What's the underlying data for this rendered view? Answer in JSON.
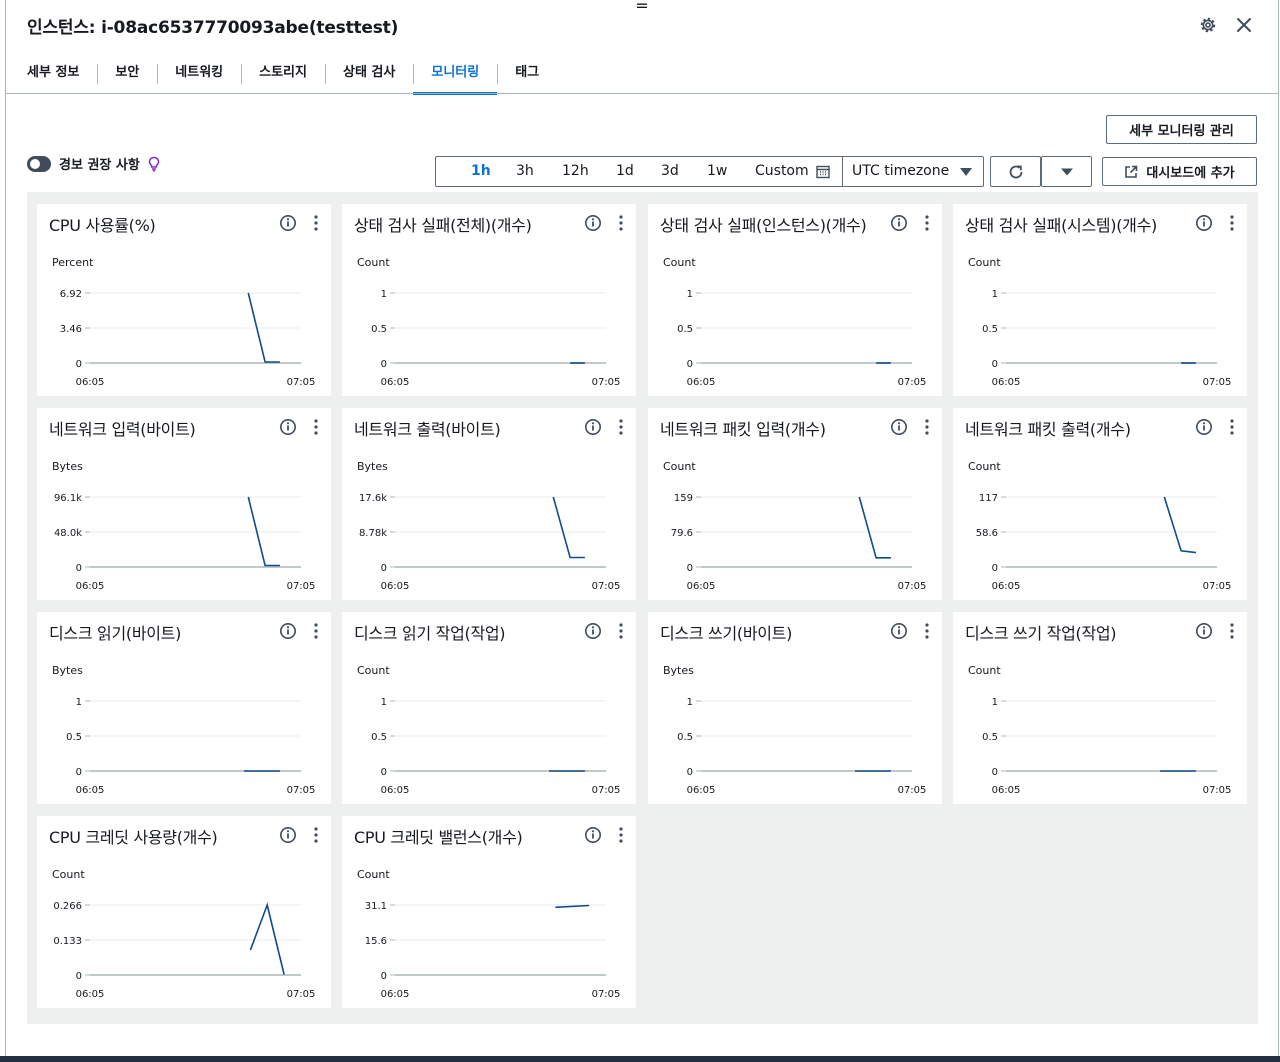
{
  "header": {
    "title": "인스턴스: i-08ac6537770093abe(testtest)",
    "drag_glyph": "=",
    "settings_icon": "gear-icon",
    "close_icon": "close-icon"
  },
  "tabs": [
    {
      "label": "세부 정보",
      "active": false
    },
    {
      "label": "보안",
      "active": false
    },
    {
      "label": "네트워킹",
      "active": false
    },
    {
      "label": "스토리지",
      "active": false
    },
    {
      "label": "상태 검사",
      "active": false
    },
    {
      "label": "모니터링",
      "active": true
    },
    {
      "label": "태그",
      "active": false
    }
  ],
  "toolbar": {
    "manage_monitoring_label": "세부 모니터링 관리",
    "alarm_toggle_label": "경보 권장 사항",
    "alarm_toggle_on": false,
    "time_ranges": [
      "1h",
      "3h",
      "12h",
      "1d",
      "3d",
      "1w",
      "Custom"
    ],
    "selected_time_range": "1h",
    "timezone": "UTC timezone",
    "add_to_dashboard_label": "대시보드에 추가"
  },
  "colors": {
    "accent": "#0972d3",
    "series_line": "#0f4c8a",
    "panel_background": "#eef0f0"
  },
  "widgets": [
    {
      "title": "CPU 사용률(%)",
      "unit": "Percent",
      "y_ticks": [
        "6.92",
        "3.46",
        "0"
      ],
      "x_ticks": [
        "06:05",
        "07:05"
      ]
    },
    {
      "title": "상태 검사 실패(전체)(개수)",
      "unit": "Count",
      "y_ticks": [
        "1",
        "0.5",
        "0"
      ],
      "x_ticks": [
        "06:05",
        "07:05"
      ]
    },
    {
      "title": "상태 검사 실패(인스턴스)(개수)",
      "unit": "Count",
      "y_ticks": [
        "1",
        "0.5",
        "0"
      ],
      "x_ticks": [
        "06:05",
        "07:05"
      ]
    },
    {
      "title": "상태 검사 실패(시스템)(개수)",
      "unit": "Count",
      "y_ticks": [
        "1",
        "0.5",
        "0"
      ],
      "x_ticks": [
        "06:05",
        "07:05"
      ]
    },
    {
      "title": "네트워크 입력(바이트)",
      "unit": "Bytes",
      "y_ticks": [
        "96.1k",
        "48.0k",
        "0"
      ],
      "x_ticks": [
        "06:05",
        "07:05"
      ]
    },
    {
      "title": "네트워크 출력(바이트)",
      "unit": "Bytes",
      "y_ticks": [
        "17.6k",
        "8.78k",
        "0"
      ],
      "x_ticks": [
        "06:05",
        "07:05"
      ]
    },
    {
      "title": "네트워크 패킷 입력(개수)",
      "unit": "Count",
      "y_ticks": [
        "159",
        "79.6",
        "0"
      ],
      "x_ticks": [
        "06:05",
        "07:05"
      ]
    },
    {
      "title": "네트워크 패킷 출력(개수)",
      "unit": "Count",
      "y_ticks": [
        "117",
        "58.6",
        "0"
      ],
      "x_ticks": [
        "06:05",
        "07:05"
      ]
    },
    {
      "title": "디스크 읽기(바이트)",
      "unit": "Bytes",
      "y_ticks": [
        "1",
        "0.5",
        "0"
      ],
      "x_ticks": [
        "06:05",
        "07:05"
      ]
    },
    {
      "title": "디스크 읽기 작업(작업)",
      "unit": "Count",
      "y_ticks": [
        "1",
        "0.5",
        "0"
      ],
      "x_ticks": [
        "06:05",
        "07:05"
      ]
    },
    {
      "title": "디스크 쓰기(바이트)",
      "unit": "Bytes",
      "y_ticks": [
        "1",
        "0.5",
        "0"
      ],
      "x_ticks": [
        "06:05",
        "07:05"
      ]
    },
    {
      "title": "디스크 쓰기 작업(작업)",
      "unit": "Count",
      "y_ticks": [
        "1",
        "0.5",
        "0"
      ],
      "x_ticks": [
        "06:05",
        "07:05"
      ]
    },
    {
      "title": "CPU 크레딧 사용량(개수)",
      "unit": "Count",
      "y_ticks": [
        "0.266",
        "0.133",
        "0"
      ],
      "x_ticks": [
        "06:05",
        "07:05"
      ]
    },
    {
      "title": "CPU 크레딧 밸런스(개수)",
      "unit": "Count",
      "y_ticks": [
        "31.1",
        "15.6",
        "0"
      ],
      "x_ticks": [
        "06:05",
        "07:05"
      ]
    }
  ],
  "chart_data": [
    {
      "type": "line",
      "title": "CPU 사용률(%)",
      "ylabel": "Percent",
      "x_range": [
        "06:05",
        "07:05"
      ],
      "ylim": [
        0,
        6.92
      ],
      "series": [
        {
          "x": [
            0.75,
            0.83,
            0.9
          ],
          "y": [
            6.92,
            0.1,
            0.1
          ]
        }
      ]
    },
    {
      "type": "line",
      "title": "상태 검사 실패(전체)(개수)",
      "ylabel": "Count",
      "x_range": [
        "06:05",
        "07:05"
      ],
      "ylim": [
        0,
        1
      ],
      "series": [
        {
          "x": [
            0.83,
            0.9
          ],
          "y": [
            0,
            0
          ]
        }
      ]
    },
    {
      "type": "line",
      "title": "상태 검사 실패(인스턴스)(개수)",
      "ylabel": "Count",
      "x_range": [
        "06:05",
        "07:05"
      ],
      "ylim": [
        0,
        1
      ],
      "series": [
        {
          "x": [
            0.83,
            0.9
          ],
          "y": [
            0,
            0
          ]
        }
      ]
    },
    {
      "type": "line",
      "title": "상태 검사 실패(시스템)(개수)",
      "ylabel": "Count",
      "x_range": [
        "06:05",
        "07:05"
      ],
      "ylim": [
        0,
        1
      ],
      "series": [
        {
          "x": [
            0.83,
            0.9
          ],
          "y": [
            0,
            0
          ]
        }
      ]
    },
    {
      "type": "line",
      "title": "네트워크 입력(바이트)",
      "ylabel": "Bytes",
      "x_range": [
        "06:05",
        "07:05"
      ],
      "ylim": [
        0,
        96100
      ],
      "series": [
        {
          "x": [
            0.75,
            0.83,
            0.9
          ],
          "y": [
            96100,
            2000,
            2000
          ]
        }
      ]
    },
    {
      "type": "line",
      "title": "네트워크 출력(바이트)",
      "ylabel": "Bytes",
      "x_range": [
        "06:05",
        "07:05"
      ],
      "ylim": [
        0,
        17600
      ],
      "series": [
        {
          "x": [
            0.75,
            0.83,
            0.9
          ],
          "y": [
            17600,
            2400,
            2400
          ]
        }
      ]
    },
    {
      "type": "line",
      "title": "네트워크 패킷 입력(개수)",
      "ylabel": "Count",
      "x_range": [
        "06:05",
        "07:05"
      ],
      "ylim": [
        0,
        159
      ],
      "series": [
        {
          "x": [
            0.75,
            0.83,
            0.9
          ],
          "y": [
            159,
            21,
            21
          ]
        }
      ]
    },
    {
      "type": "line",
      "title": "네트워크 패킷 출력(개수)",
      "ylabel": "Count",
      "x_range": [
        "06:05",
        "07:05"
      ],
      "ylim": [
        0,
        117
      ],
      "series": [
        {
          "x": [
            0.75,
            0.83,
            0.9
          ],
          "y": [
            117,
            27,
            24
          ]
        }
      ]
    },
    {
      "type": "line",
      "title": "디스크 읽기(바이트)",
      "ylabel": "Bytes",
      "x_range": [
        "06:05",
        "07:05"
      ],
      "ylim": [
        0,
        1
      ],
      "series": [
        {
          "x": [
            0.73,
            0.9
          ],
          "y": [
            0,
            0
          ]
        }
      ]
    },
    {
      "type": "line",
      "title": "디스크 읽기 작업(작업)",
      "ylabel": "Count",
      "x_range": [
        "06:05",
        "07:05"
      ],
      "ylim": [
        0,
        1
      ],
      "series": [
        {
          "x": [
            0.73,
            0.9
          ],
          "y": [
            0,
            0
          ]
        }
      ]
    },
    {
      "type": "line",
      "title": "디스크 쓰기(바이트)",
      "ylabel": "Bytes",
      "x_range": [
        "06:05",
        "07:05"
      ],
      "ylim": [
        0,
        1
      ],
      "series": [
        {
          "x": [
            0.73,
            0.9
          ],
          "y": [
            0,
            0
          ]
        }
      ]
    },
    {
      "type": "line",
      "title": "디스크 쓰기 작업(작업)",
      "ylabel": "Count",
      "x_range": [
        "06:05",
        "07:05"
      ],
      "ylim": [
        0,
        1
      ],
      "series": [
        {
          "x": [
            0.73,
            0.9
          ],
          "y": [
            0,
            0
          ]
        }
      ]
    },
    {
      "type": "line",
      "title": "CPU 크레딧 사용량(개수)",
      "ylabel": "Count",
      "x_range": [
        "06:05",
        "07:05"
      ],
      "ylim": [
        0,
        0.266
      ],
      "series": [
        {
          "x": [
            0.76,
            0.84,
            0.92
          ],
          "y": [
            0.095,
            0.266,
            0.002
          ]
        }
      ]
    },
    {
      "type": "line",
      "title": "CPU 크레딧 밸런스(개수)",
      "ylabel": "Count",
      "x_range": [
        "06:05",
        "07:05"
      ],
      "ylim": [
        0,
        31.1
      ],
      "series": [
        {
          "x": [
            0.76,
            0.92
          ],
          "y": [
            30.1,
            30.9
          ]
        }
      ]
    }
  ]
}
